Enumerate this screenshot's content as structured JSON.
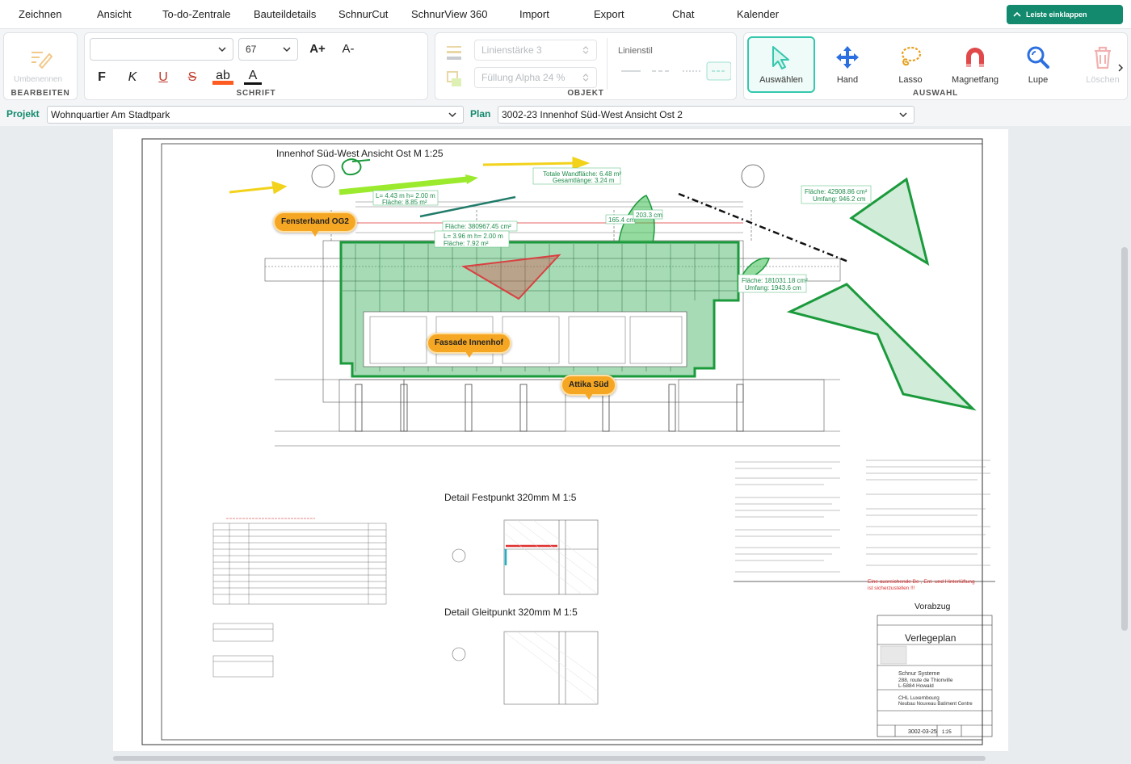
{
  "menu": {
    "items": [
      "Zeichnen",
      "Ansicht",
      "To-do-Zentrale",
      "Bauteildetails",
      "SchnurCut",
      "SchnurView 360",
      "Import",
      "Export",
      "Chat",
      "Kalender"
    ],
    "collapse_label": "Leiste einklappen"
  },
  "ribbon": {
    "bearbeiten": {
      "label": "BEARBEITEN",
      "rename_label": "Umbenennen"
    },
    "schrift": {
      "label": "SCHRIFT",
      "font_value": "",
      "size_value": "67",
      "grow": "A+",
      "shrink": "A-",
      "bold": "F",
      "italic": "K",
      "underline": "U",
      "strike": "S",
      "highlight": "ab",
      "color": "A"
    },
    "objekt": {
      "label": "OBJEKT",
      "line_width": "Linienstärke 3",
      "fill_alpha": "Füllung Alpha 24 %",
      "line_style_label": "Linienstil"
    },
    "auswahl": {
      "label": "AUSWAHL",
      "tools": [
        "Auswählen",
        "Hand",
        "Lasso",
        "Magnetfang",
        "Lupe",
        "Löschen"
      ]
    }
  },
  "project": {
    "project_label": "Projekt",
    "project_value": "Wohnquartier Am Stadtpark",
    "plan_label": "Plan",
    "plan_value": "3002-23 Innenhof Süd-West Ansicht Ost 2"
  },
  "drawing": {
    "title": "Innenhof Süd-West Ansicht Ost  M 1:25",
    "pins": [
      "Fensterband OG2",
      "Fassade Innenhof",
      "Attika Süd"
    ],
    "measures": {
      "m1a": "L= 4.43 m  h= 2.00 m",
      "m1b": "Fläche: 8.85 m²",
      "m2a": "Totale Wandfläche: 6.48 m²",
      "m2b": "Gesamtlänge: 3.24 m",
      "m3": "Fläche: 380967.45 cm²",
      "m4a": "L= 3.96 m  h= 2.00 m",
      "m4b": "Fläche: 7.92 m²",
      "m5a": "Fläche: 42908.86 cm²",
      "m5b": "Umfang: 946.2 cm",
      "m6a": "Fläche: 181031.18 cm²",
      "m6b": "Umfang: 1943.6 cm",
      "m7": "165.4 cm",
      "m8": "203.3 cm"
    },
    "detail1": "Detail Festpunkt 320mm  M 1:5",
    "detail2": "Detail Gleitpunkt 320mm  M 1:5",
    "vorabzug": "Vorabzug",
    "titleblock": {
      "heading": "Verlegeplan",
      "company": "Schnur Systeme",
      "address1": "288, route de Thionville",
      "address2": "L-5884 Howald",
      "client1": "CHL Luxembourg",
      "client2": "Neubau Nouveau Batiment Centre",
      "plan_no": "3002-03-25",
      "scale": "1:25"
    },
    "red_note1": "Eine ausreichende Be-, Ent- und Hinterlüftung",
    "red_note2": "ist sicherzustellen !!!"
  }
}
